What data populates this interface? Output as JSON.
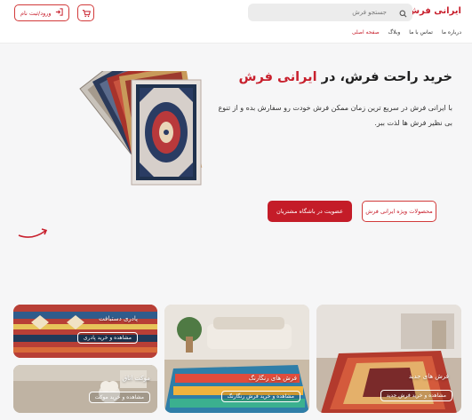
{
  "header": {
    "logo": "ایرانی فرش",
    "search_placeholder": "جستجو فرش",
    "login_label": "ورود/ثبت نام",
    "nav": [
      "صفحه اصلی",
      "وبلاگ",
      "تماس با ما",
      "درباره ما"
    ]
  },
  "hero": {
    "title_prefix": "خرید راحت فرش، در",
    "title_brand": "ایرانی فرش",
    "description": "با ایرانی فرش در سریع ترین زمان ممکن فرش خودت رو سفارش بده و از تنوع بی نظیر فرش ها لذت ببر.",
    "products_button": "محصولات ویژه ایرانی فرش",
    "club_button": "عضویت در باشگاه مشتریان"
  },
  "categories": [
    {
      "title": "فرش های جدید",
      "button": "مشاهده و خرید فرش جدید"
    },
    {
      "title": "فرش های رنگارنگ",
      "button": "مشاهده و خرید فرش رنگارنگ"
    },
    {
      "title": "پادری دستبافت",
      "button": "مشاهده و خرید پادری"
    },
    {
      "title": "موکت اتاق",
      "button": "مشاهده و خرید موکت"
    }
  ],
  "colors": {
    "accent": "#c8202d",
    "accent_dark": "#c41c28"
  }
}
